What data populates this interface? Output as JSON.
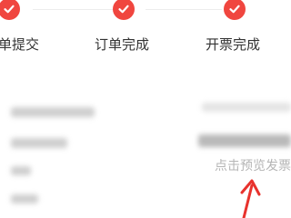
{
  "accent_color": "#f0463f",
  "steps": [
    {
      "label": "单提交",
      "icon": "check-icon"
    },
    {
      "label": "订单完成",
      "icon": "check-icon"
    },
    {
      "label": "开票完成",
      "icon": "check-icon"
    }
  ],
  "preview_link": "点击预览发票",
  "annotation_arrow_color": "#e8322d"
}
